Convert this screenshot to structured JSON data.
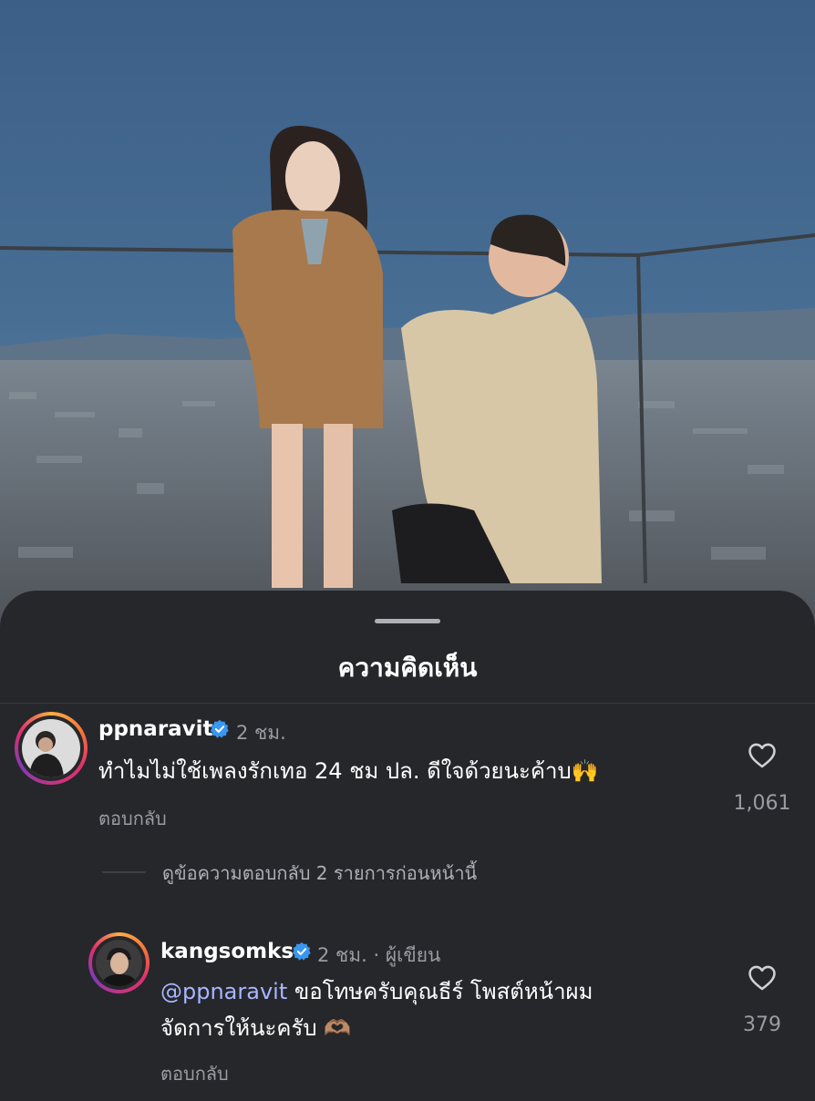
{
  "sheet": {
    "title": "ความคิดเห็น"
  },
  "comments": [
    {
      "username": "ppnaravit",
      "time": "2 ชม.",
      "text": "ทำไมไม่ใช้เพลงรักเทอ 24 ชม ปล. ดีใจด้วยนะค้าบ🙌",
      "reply_label": "ตอบกลับ",
      "likes": "1,061",
      "avatar_icon": "user-avatar",
      "like_icon": "heart-outline-icon"
    }
  ],
  "view_replies": "ดูข้อความตอบกลับ 2 รายการก่อนหน้านี้",
  "reply_comment": {
    "username": "kangsomks",
    "time": "2 ชม.",
    "separator": "·",
    "author_badge": "ผู้เขียน",
    "mention": "@ppnaravit",
    "text_line1": " ขอโทษครับคุณธีร์ โพสต์หน้าผม",
    "text_line2": "จัดการให้นะครับ 🫶🏽",
    "reply_label": "ตอบกลับ",
    "likes": "379"
  },
  "colors": {
    "background": "#26272b",
    "verified": "#3897f0",
    "mention": "#a9b6ff",
    "muted": "#9a9ca2"
  }
}
